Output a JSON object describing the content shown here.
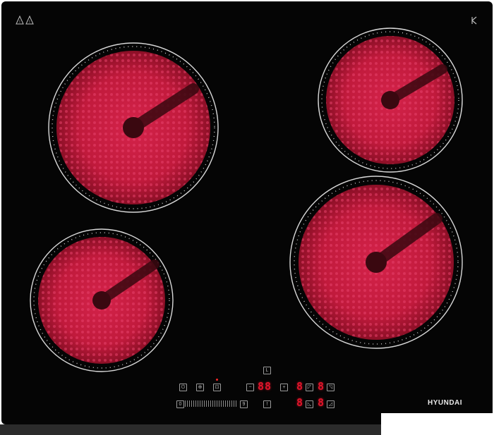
{
  "brand": {
    "label": "HYUNDAI"
  },
  "colors": {
    "glass": "#050505",
    "heat_red": "#c8203a",
    "display_red": "#e0142a",
    "frame": "#2b2b2b"
  },
  "icons": {
    "warning": "warning-triangle-icon",
    "lock": "child-lock-icon",
    "timer": "timer-icon",
    "power": "power-icon"
  },
  "displays": {
    "main": "88",
    "timer_top_left": "8",
    "timer_top_right": "8",
    "timer_bottom_left": "8",
    "timer_bottom_right": "8"
  },
  "keys": {
    "minus": "−",
    "plus": "+",
    "lock": "⊕",
    "boost": "⊡",
    "pause": "Ⅱ",
    "slider_start": "0",
    "slider_end": "9",
    "select": "!",
    "timer": "L"
  }
}
